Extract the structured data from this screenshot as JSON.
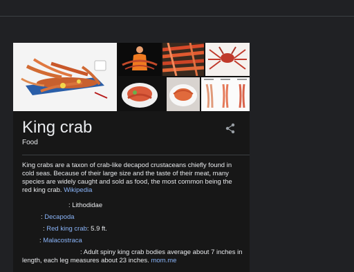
{
  "knowledge_panel": {
    "title": "King crab",
    "subtitle": "Food",
    "description": "King crabs are a taxon of crab-like decapod crustaceans chiefly found in cold seas. Because of their large size and the taste of their meat, many species are widely caught and sold as food, the most common being the red king crab.",
    "description_source": "Wikipedia",
    "facts": {
      "family_label": ": ",
      "family_value": "Lithodidae",
      "order_label": ": ",
      "order_value": "Decapoda",
      "size_label": ": ",
      "size_species": "Red king crab",
      "size_value": ": 5.9 ft.",
      "class_label": ": ",
      "class_value": "Malacostraca",
      "length_label": ": ",
      "length_text": "Adult spiny king crab bodies average about 7 inches in length, each leg measures about 23 inches.",
      "length_source": "mom.me"
    },
    "share_icon": "share-icon"
  },
  "colors": {
    "background": "#202124",
    "panel": "#171717",
    "text": "#e8eaed",
    "link": "#8ab4f8",
    "divider": "#3c4043"
  }
}
